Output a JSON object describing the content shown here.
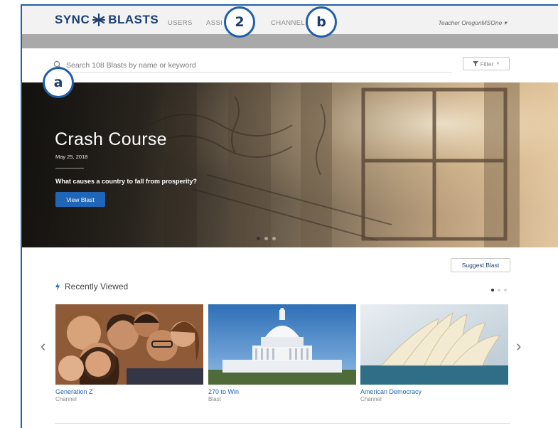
{
  "header": {
    "brand_left": "SYNC",
    "brand_right": "BLASTS",
    "nav": [
      "USERS",
      "ASSI",
      "CHANNELS"
    ],
    "user_menu": "Teacher OregonMSOne ▾"
  },
  "search": {
    "placeholder": "Search 108 Blasts by name or keyword",
    "filter_label": "Filter"
  },
  "hero": {
    "title": "Crash Course",
    "date": "May 25, 2018",
    "description": "What causes a country to fall from prosperity?",
    "button_label": "View Blast"
  },
  "actions": {
    "suggest_label": "Suggest Blast"
  },
  "recent": {
    "heading": "Recently Viewed",
    "cards": [
      {
        "title": "Generation Z",
        "type": "Channel"
      },
      {
        "title": "270 to Win",
        "type": "Blast"
      },
      {
        "title": "American Democracy",
        "type": "Channel"
      }
    ]
  },
  "callouts": {
    "a": "a",
    "two": "2",
    "b": "b"
  },
  "icons": [
    "snowflake-icon",
    "search-icon",
    "filter-icon",
    "bolt-icon",
    "chevron-left-icon",
    "chevron-right-icon"
  ],
  "colors": {
    "brand": "#1c3e73",
    "accent": "#1f66b8",
    "callout_border": "#1f5fa8"
  }
}
